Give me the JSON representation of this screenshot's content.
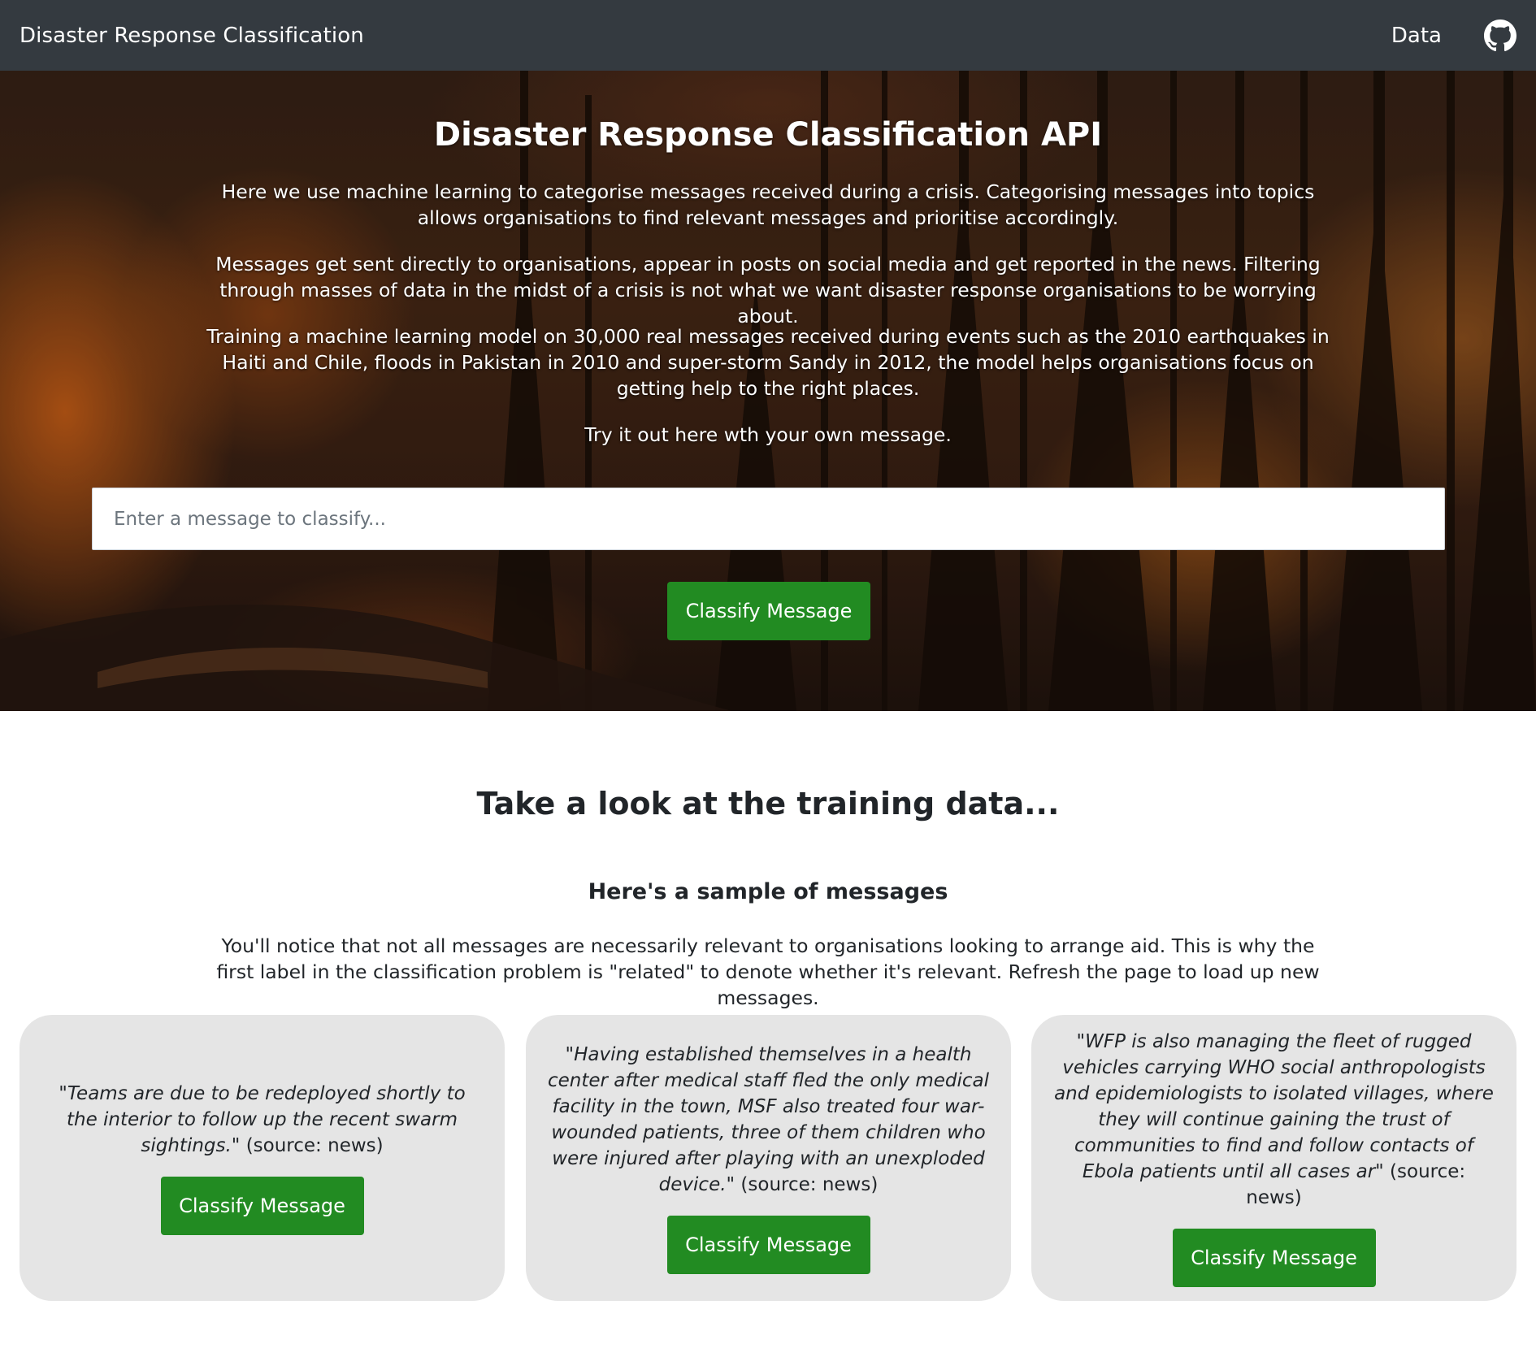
{
  "navbar": {
    "brand": "Disaster Response Classification",
    "data_link": "Data",
    "github_icon": "github-icon"
  },
  "hero": {
    "title": "Disaster Response Classification API",
    "paragraphs": [
      "Here we use machine learning to categorise messages received during a crisis. Categorising messages into topics allows organisations to find relevant messages and prioritise accordingly.",
      "Messages get sent directly to organisations, appear in posts on social media and get reported in the news. Filtering through masses of data in the midst of a crisis is not what we want disaster response organisations to be worrying about.",
      "Training a machine learning model on 30,000 real messages received during events such as the 2010 earthquakes in Haiti and Chile, floods in Pakistan in 2010 and super-storm Sandy in 2012, the model helps organisations focus on getting help to the right places.",
      "Try it out here wth your own message."
    ],
    "input_placeholder": "Enter a message to classify...",
    "input_value": "",
    "button_label": "Classify Message"
  },
  "training": {
    "title": "Take a look at the training data...",
    "subtitle": "Here's a sample of messages",
    "description": "You'll notice that not all messages are necessarily relevant to organisations looking to arrange aid. This is why the first label in the classification problem is \"related\" to denote whether it's relevant. Refresh the page to load up new messages.",
    "samples": [
      {
        "message": "\"Teams are due to be redeployed shortly to the interior to follow up the recent swarm sightings.\"",
        "source": " (source: news)",
        "button_label": "Classify Message"
      },
      {
        "message": "\"Having established themselves in a health center after medical staff fled the only medical facility in the town, MSF also treated four war-wounded patients, three of them children who were injured after playing with an unexploded device.\"",
        "source": " (source: news)",
        "button_label": "Classify Message"
      },
      {
        "message": "\"WFP is also managing the fleet of rugged vehicles carrying WHO social anthropologists and epidemiologists to isolated villages, where they will continue gaining the trust of communities to find and follow contacts of Ebola patients until all cases ar\"",
        "source": " (source: news)",
        "button_label": "Classify Message"
      }
    ]
  },
  "colors": {
    "navbar_bg": "#343a40",
    "button_green": "#228b22",
    "card_bg": "#e5e5e5"
  }
}
